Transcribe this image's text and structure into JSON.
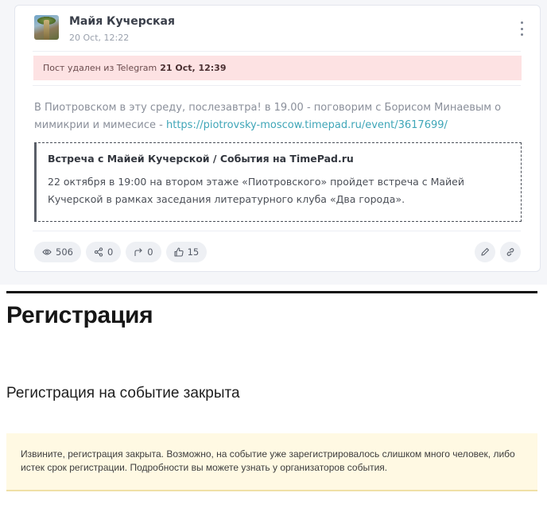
{
  "post": {
    "author": "Майя Кучерская",
    "date": "20 Oct, 12:22",
    "deleted_label": "Пост удален из Telegram",
    "deleted_at": "21 Oct, 12:39",
    "text": "В Пиотровском в эту среду, послезавтра! в 19.00 - поговорим с Борисом Минаевым о мимикрии и мимесисе - ",
    "link": "https://piotrovsky-moscow.timepad.ru/event/3617699/",
    "preview": {
      "title": "Встреча с Майей Кучерской / События на TimePad.ru",
      "description": "22 октября в 19:00 на втором этаже «Пиотровского» пройдет встреча с Майей Кучерской в рамках заседания литературного клуба «Два города»."
    },
    "stats": {
      "views": "506",
      "shares": "0",
      "forwards": "0",
      "likes": "15"
    },
    "icons": {
      "views": "eye-icon",
      "shares": "share-icon",
      "forwards": "forward-arrow-icon",
      "likes": "thumbs-up-icon",
      "edit": "pencil-icon",
      "link": "link-icon",
      "menu": "kebab-menu-icon"
    }
  },
  "registration": {
    "heading": "Регистрация",
    "subheading": "Регистрация на событие закрыта",
    "notice": "Извините, регистрация закрыта. Возможно, на событие уже зарегистрировалось слишком много человек, либо истек срок регистрации. Подробности вы можете узнать у организаторов события."
  },
  "colors": {
    "deleted_banner_bg": "#fde2e3",
    "link": "#3fa6b8",
    "notice_bg": "#fff9e3"
  }
}
